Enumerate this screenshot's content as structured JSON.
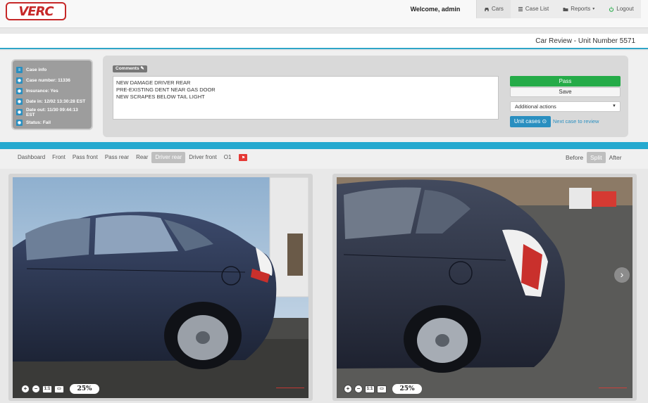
{
  "header": {
    "logo_text": "VERC",
    "welcome": "Welcome, admin",
    "nav": [
      {
        "label": "Cars",
        "icon": "car-icon"
      },
      {
        "label": "Case List",
        "icon": "list-icon"
      },
      {
        "label": "Reports",
        "icon": "folder-icon",
        "caret": "▾"
      },
      {
        "label": "Logout",
        "icon": "power-icon"
      }
    ]
  },
  "page_title": "Car Review - Unit Number 5571",
  "case_info": {
    "items": [
      "Case info",
      "Case number: 11336",
      "Insurance: Yes",
      "Date in: 12/02 13:30:28 EST",
      "Date out: 11/30 09:44:13 EST",
      "Status: Fail"
    ]
  },
  "comments": {
    "label": "Comments",
    "value": "NEW DAMAGE DRIVER REAR\nPRE-EXISTING DENT NEAR GAS DOOR\nNEW SCRAPES BELOW TAIL LIGHT"
  },
  "actions": {
    "pass": "Pass",
    "save": "Save",
    "additional": "Additional actions",
    "unit_cases": "Unit cases",
    "next_case": "Next case to review"
  },
  "tabs": [
    "Dashboard",
    "Front",
    "Pass front",
    "Pass rear",
    "Rear",
    "Driver rear",
    "Driver front",
    "O1"
  ],
  "active_tab": "Driver rear",
  "view_modes": [
    "Before",
    "Split",
    "After"
  ],
  "active_view": "Split",
  "images": {
    "left": {
      "zoom": "25%"
    },
    "right": {
      "zoom": "25%"
    }
  },
  "colors": {
    "accent": "#24a9cf",
    "pass": "#25ab48",
    "brand": "#c62828",
    "unit_button": "#2a8fc0"
  }
}
